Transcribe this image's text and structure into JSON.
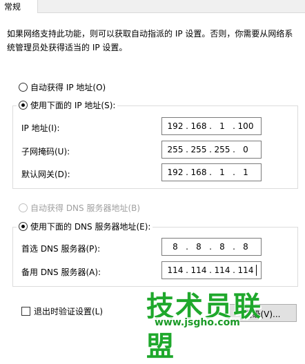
{
  "tab": {
    "label": "常规"
  },
  "description": "如果网络支持此功能，则可以获取自动指派的 IP 设置。否则，你需要从网络系统管理员处获得适当的 IP 设置。",
  "ip": {
    "auto_label": "自动获得 IP 地址(O)",
    "manual_label": "使用下面的 IP 地址(S):",
    "selected": "manual",
    "fields": [
      {
        "label": "IP 地址(I):",
        "octets": [
          "192",
          "168",
          "1",
          "100"
        ]
      },
      {
        "label": "子网掩码(U):",
        "octets": [
          "255",
          "255",
          "255",
          "0"
        ]
      },
      {
        "label": "默认网关(D):",
        "octets": [
          "192",
          "168",
          "1",
          "1"
        ]
      }
    ]
  },
  "dns": {
    "auto_label": "自动获得 DNS 服务器地址(B)",
    "auto_disabled": true,
    "manual_label": "使用下面的 DNS 服务器地址(E):",
    "selected": "manual",
    "fields": [
      {
        "label": "首选 DNS 服务器(P):",
        "octets": [
          "8",
          "8",
          "8",
          "8"
        ]
      },
      {
        "label": "备用 DNS 服务器(A):",
        "octets": [
          "114",
          "114",
          "114",
          "114"
        ]
      }
    ]
  },
  "validate_checkbox": {
    "label": "退出时验证设置(L)",
    "checked": false
  },
  "advanced_button": {
    "label": "高级(V)..."
  },
  "watermark": {
    "main": "技术员联盟",
    "sub": "www.jsgho.com"
  },
  "colors": {
    "watermark": "#1fa82c",
    "border": "#7a7a7a"
  }
}
